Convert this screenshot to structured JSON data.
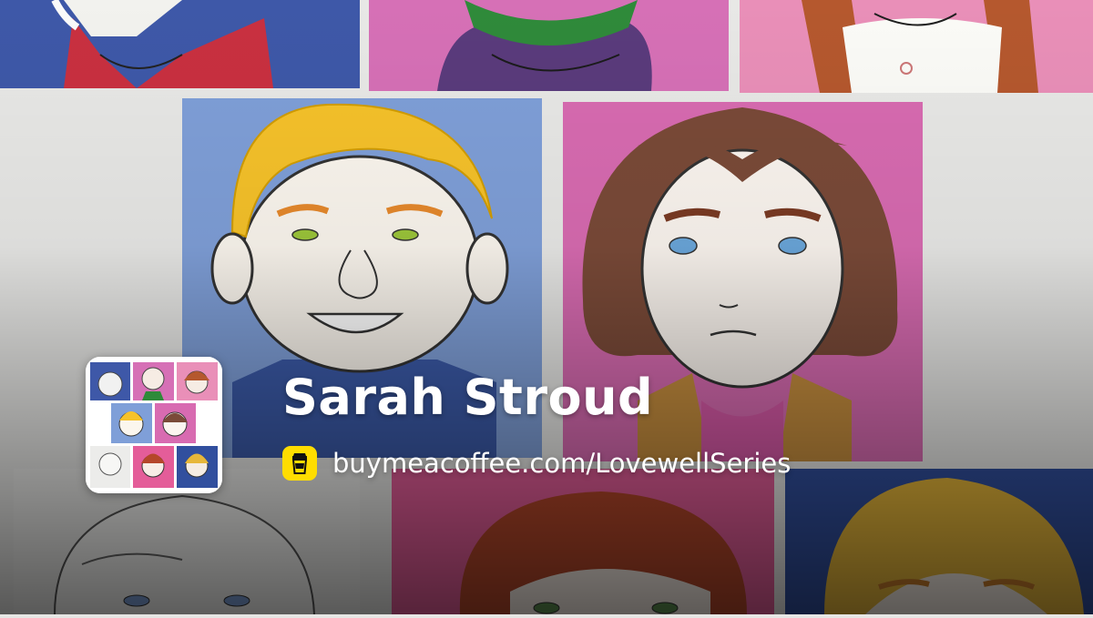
{
  "profile": {
    "name": "Sarah Stroud",
    "url": "buymeacoffee.com/LovewellSeries"
  },
  "icons": {
    "cup": "coffee-cup-icon"
  },
  "colors": {
    "badge": "#ffdd00",
    "text": "#ffffff"
  }
}
